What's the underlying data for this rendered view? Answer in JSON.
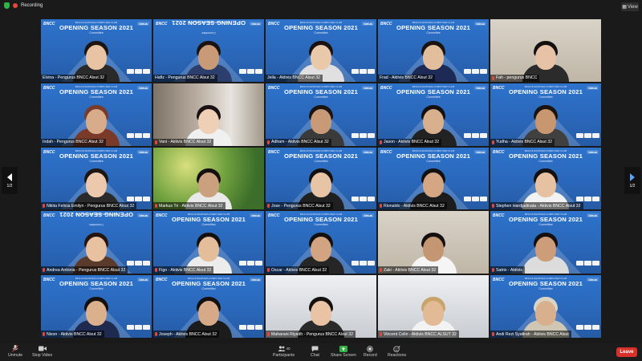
{
  "topbar": {
    "recording_label": "Recording",
    "view_label": "View"
  },
  "banner": {
    "brand": "BNCC",
    "brand_right": "binus",
    "title": "OPENING SEASON 2021",
    "subtitle": "Committee",
    "subtop": "BINA NUSANTARA COMPUTER CLUB"
  },
  "pagination": {
    "left": "1/2",
    "right": "1/2"
  },
  "participants": [
    {
      "name": "Elvina - Pengurus BNCC Alsut 32",
      "skin": "#e8c3a4",
      "hair": "#1e1410",
      "shirt": "#2a2a2a",
      "bg": "banner",
      "muted": false
    },
    {
      "name": "Hafiz - Pengurus BNCC Alsut 32",
      "skin": "#c89a78",
      "hair": "#1a1410",
      "shirt": "#2c3e6b",
      "bg": "banner-flip",
      "muted": false
    },
    {
      "name": "Jella - Aktivis BNCC Alsut 32",
      "skin": "#e9c9a9",
      "hair": "#1a1212",
      "shirt": "#e0e0e0",
      "bg": "banner",
      "muted": false
    },
    {
      "name": "Frad - Aktivis BNCC Alsut 32",
      "skin": "#e3be9c",
      "hair": "#1a1410",
      "shirt": "#1d2a55",
      "bg": "banner",
      "muted": false
    },
    {
      "name": "Fah - pengurus BNCC",
      "skin": "#e7c2a6",
      "hair": "#141010",
      "shirt": "#2b2b2b",
      "bg": "photo-wall",
      "muted": true
    },
    {
      "name": "Indah - Pengurus BNCC Alsut 32",
      "skin": "#d8ac8a",
      "hair": "#7a3a2a",
      "shirt": "#7a3a2a",
      "bg": "banner",
      "muted": false,
      "active": true
    },
    {
      "name": "Vani - Aktivis BNCC Alsut 32",
      "skin": "#efd0b6",
      "hair": "#1a1212",
      "shirt": "#f0f0f0",
      "bg": "photo-room",
      "muted": true
    },
    {
      "name": "Adham - Aktivis BNCC Alsut 32",
      "skin": "#c99a78",
      "hair": "#1a1410",
      "shirt": "#3a3a3a",
      "bg": "banner",
      "muted": true
    },
    {
      "name": "Jason - Aktivis BNCC Alsut 32",
      "skin": "#d9b08e",
      "hair": "#141010",
      "shirt": "#222222",
      "bg": "banner",
      "muted": true
    },
    {
      "name": "Yudha - Aktivis BNCC Alsut 32",
      "skin": "#c8966f",
      "hair": "#1a1410",
      "shirt": "#404040",
      "bg": "banner",
      "muted": true
    },
    {
      "name": "Nikita Felicia Emilyn - Pengurus BNCC Alsut 32",
      "skin": "#ecc8ad",
      "hair": "#1e1612",
      "shirt": "#2a2a2a",
      "bg": "banner",
      "muted": true
    },
    {
      "name": "Markus Tri - Aktivis BNCC Alsut 32",
      "skin": "#caa07e",
      "hair": "#141010",
      "shirt": "#e9e9e9",
      "bg": "photo-green",
      "muted": true
    },
    {
      "name": "Jose - Pengurus BNCC Alsut 32",
      "skin": "#e7c4a5",
      "hair": "#121010",
      "shirt": "#202020",
      "bg": "banner",
      "muted": true
    },
    {
      "name": "Rionaldo - Aktivis BNCC Alsut 32",
      "skin": "#d4a684",
      "hair": "#121010",
      "shirt": "#1c1c1c",
      "bg": "banner",
      "muted": true
    },
    {
      "name": "Stephen Hardjadinata - Aktivis BNCC Alsut 32",
      "skin": "#e6c2a2",
      "hair": "#141010",
      "shirt": "#f2f2f2",
      "bg": "banner",
      "muted": true
    },
    {
      "name": "Andrea Antonia - Pengurus BNCC Alsut 32",
      "skin": "#e8c1a1",
      "hair": "#24160f",
      "shirt": "#5a3a2a",
      "bg": "banner-flip",
      "muted": true
    },
    {
      "name": "Figo - Aktivis BNCC Alsut 32",
      "skin": "#e4bd9b",
      "hair": "#141010",
      "shirt": "#ececec",
      "bg": "banner",
      "muted": true
    },
    {
      "name": "Oscar - Aktivis BNCC Alsut 32",
      "skin": "#d2a481",
      "hair": "#141010",
      "shirt": "#262626",
      "bg": "banner",
      "muted": true
    },
    {
      "name": "Zaki - Aktivis BNCC Alsut 32",
      "skin": "#c59672",
      "hair": "#141010",
      "shirt": "#f5f5f5",
      "bg": "photo-wall",
      "muted": true
    },
    {
      "name": "Satrio - Aktivis",
      "skin": "#cc9d78",
      "hair": "#141010",
      "shirt": "#dcdcdc",
      "bg": "banner",
      "muted": true
    },
    {
      "name": "Nixon - Aktivis BNCC Alsut 32",
      "skin": "#dbb08d",
      "hair": "#141010",
      "shirt": "#1e2a50",
      "bg": "banner",
      "muted": true
    },
    {
      "name": "Joseph - Aktivis BNCC Alsut 32",
      "skin": "#d6aa88",
      "hair": "#141010",
      "shirt": "#1c1c1c",
      "bg": "banner",
      "muted": true
    },
    {
      "name": "Maharani Riyadh - Pengurus BNCC Alsut 32",
      "skin": "#e9c3a4",
      "hair": "#141010",
      "shirt": "#2a2a2a",
      "bg": "photo-white",
      "muted": true
    },
    {
      "name": "Vincent Colin - Aktivis BNCC ALSUT 32",
      "skin": "#e2ba95",
      "hair": "#c9a46a",
      "shirt": "#f2f2f2",
      "bg": "photo-white",
      "muted": true
    },
    {
      "name": "Andi Rezi Syafirah - Aktivis BNCC Alsut",
      "skin": "#d8b08e",
      "hair": "#d9d4c6",
      "shirt": "#cfc7b4",
      "bg": "banner",
      "muted": true
    }
  ],
  "toolbar": {
    "unmute": "Unmute",
    "stop_video": "Stop Video",
    "participants_count": "40",
    "participants": "Participants",
    "chat": "Chat",
    "share_screen": "Share Screen",
    "record": "Record",
    "reactions": "Reactions",
    "leave": "Leave"
  }
}
